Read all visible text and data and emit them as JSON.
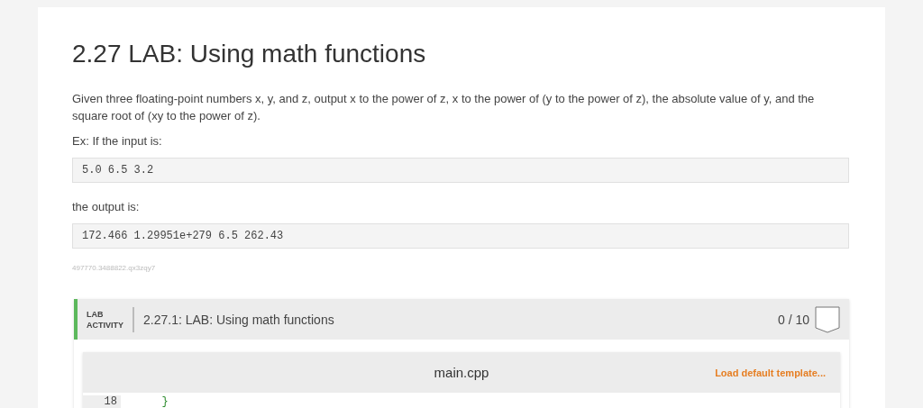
{
  "title": "2.27 LAB: Using math functions",
  "description": "Given three floating-point numbers x, y, and z, output x to the power of z, x to the power of (y to the power of z), the absolute value of y, and the square root of (xy to the power of z).",
  "input_label": "Ex: If the input is:",
  "input_example": "5.0 6.5 3.2",
  "output_label": "the output is:",
  "output_example": "172.466 1.29951e+279 6.5 262.43",
  "id_code": "497770.3488822.qx3zqy7",
  "lab_activity": {
    "tag_line_1": "LAB",
    "tag_line_2": "ACTIVITY",
    "title": "2.27.1: LAB: Using math functions",
    "score": "0 / 10"
  },
  "editor": {
    "filename": "main.cpp",
    "load_link": "Load default template...",
    "lines": [
      {
        "number": "18",
        "code": "   }"
      }
    ]
  }
}
